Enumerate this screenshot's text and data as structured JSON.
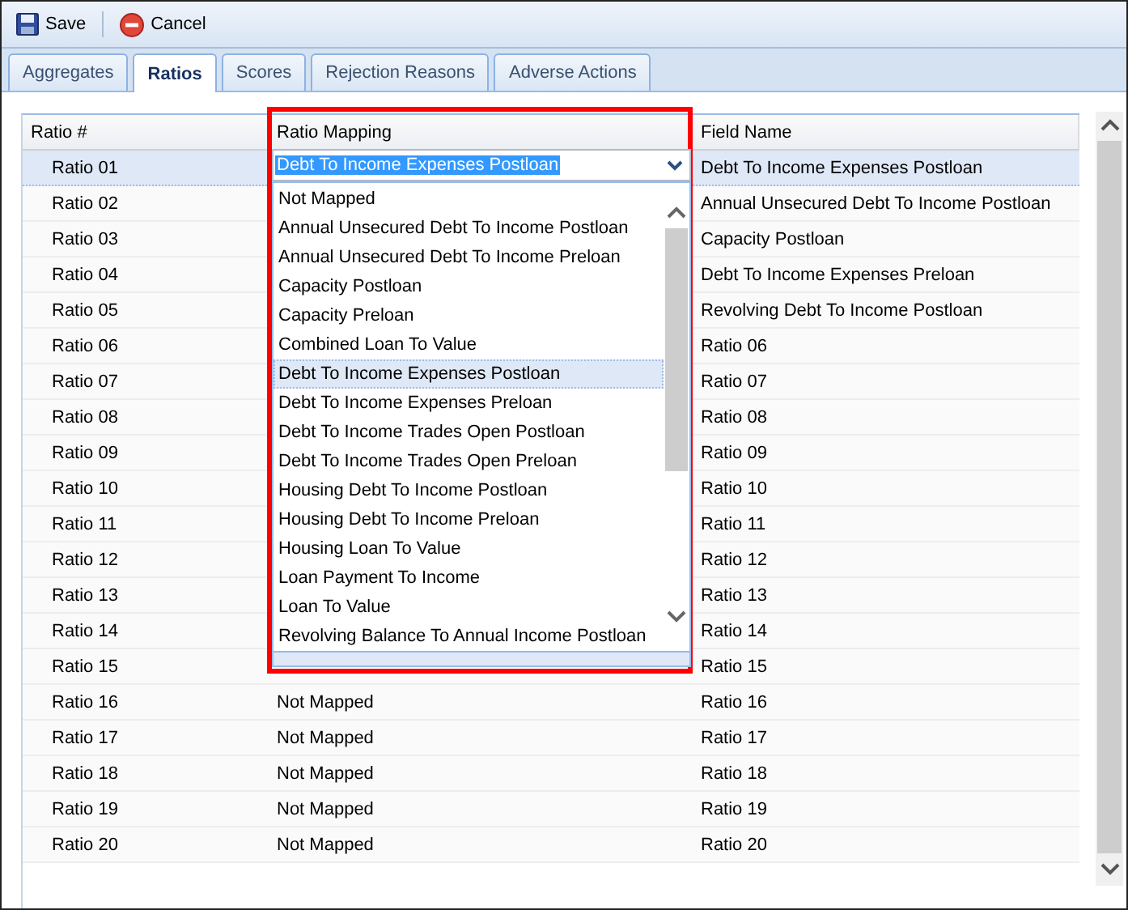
{
  "toolbar": [
    {
      "label": "Save",
      "kind": "save"
    },
    {
      "label": "Cancel",
      "kind": "cancel"
    }
  ],
  "tabs": [
    {
      "label": "Aggregates",
      "selected": false
    },
    {
      "label": "Ratios",
      "selected": true
    },
    {
      "label": "Scores",
      "selected": false
    },
    {
      "label": "Rejection Reasons",
      "selected": false
    },
    {
      "label": "Adverse Actions",
      "selected": false
    }
  ],
  "table": {
    "columns": [
      "Ratio #",
      "Ratio Mapping",
      "Field Name"
    ],
    "rows": [
      {
        "ratio": "Ratio 01",
        "field": "Debt To Income Expenses Postloan",
        "selected": true
      },
      {
        "ratio": "Ratio 02",
        "field": "Annual Unsecured Debt To Income Postloan",
        "selected": false
      },
      {
        "ratio": "Ratio 03",
        "field": "Capacity Postloan",
        "selected": false
      },
      {
        "ratio": "Ratio 04",
        "field": "Debt To Income Expenses Preloan",
        "selected": false
      },
      {
        "ratio": "Ratio 05",
        "field": "Revolving Debt To Income Postloan",
        "selected": false
      },
      {
        "ratio": "Ratio 06",
        "field": "Ratio 06",
        "selected": false
      },
      {
        "ratio": "Ratio 07",
        "field": "Ratio 07",
        "selected": false
      },
      {
        "ratio": "Ratio 08",
        "field": "Ratio 08",
        "selected": false
      },
      {
        "ratio": "Ratio 09",
        "field": "Ratio 09",
        "selected": false
      },
      {
        "ratio": "Ratio 10",
        "field": "Ratio 10",
        "selected": false
      },
      {
        "ratio": "Ratio 11",
        "field": "Ratio 11",
        "selected": false
      },
      {
        "ratio": "Ratio 12",
        "field": "Ratio 12",
        "selected": false
      },
      {
        "ratio": "Ratio 13",
        "field": "Ratio 13",
        "selected": false
      },
      {
        "ratio": "Ratio 14",
        "field": "Ratio 14",
        "selected": false
      },
      {
        "ratio": "Ratio 15",
        "field": "Ratio 15",
        "selected": false
      },
      {
        "ratio": "Ratio 16",
        "mapping": "Not Mapped",
        "field": "Ratio 16",
        "selected": false
      },
      {
        "ratio": "Ratio 17",
        "mapping": "Not Mapped",
        "field": "Ratio 17",
        "selected": false
      },
      {
        "ratio": "Ratio 18",
        "mapping": "Not Mapped",
        "field": "Ratio 18",
        "selected": false
      },
      {
        "ratio": "Ratio 19",
        "mapping": "Not Mapped",
        "field": "Ratio 19",
        "selected": false
      },
      {
        "ratio": "Ratio 20",
        "mapping": "Not Mapped",
        "field": "Ratio 20",
        "selected": false
      }
    ]
  },
  "dropdown": {
    "value": "Debt To Income Expenses Postloan",
    "items": [
      {
        "label": "Not Mapped",
        "selected": false
      },
      {
        "label": "Annual Unsecured Debt To Income Postloan",
        "selected": false
      },
      {
        "label": "Annual Unsecured Debt To Income Preloan",
        "selected": false
      },
      {
        "label": "Capacity Postloan",
        "selected": false
      },
      {
        "label": "Capacity Preloan",
        "selected": false
      },
      {
        "label": "Combined Loan To Value",
        "selected": false
      },
      {
        "label": "Debt To Income Expenses Postloan",
        "selected": true
      },
      {
        "label": "Debt To Income Expenses Preloan",
        "selected": false
      },
      {
        "label": "Debt To Income Trades Open Postloan",
        "selected": false
      },
      {
        "label": "Debt To Income Trades Open Preloan",
        "selected": false
      },
      {
        "label": "Housing Debt To Income Postloan",
        "selected": false
      },
      {
        "label": "Housing Debt To Income Preloan",
        "selected": false
      },
      {
        "label": "Housing Loan To Value",
        "selected": false
      },
      {
        "label": "Loan Payment To Income",
        "selected": false
      },
      {
        "label": "Loan To Value",
        "selected": false
      },
      {
        "label": "Revolving Balance To Annual Income Postloan",
        "selected": false
      }
    ]
  }
}
